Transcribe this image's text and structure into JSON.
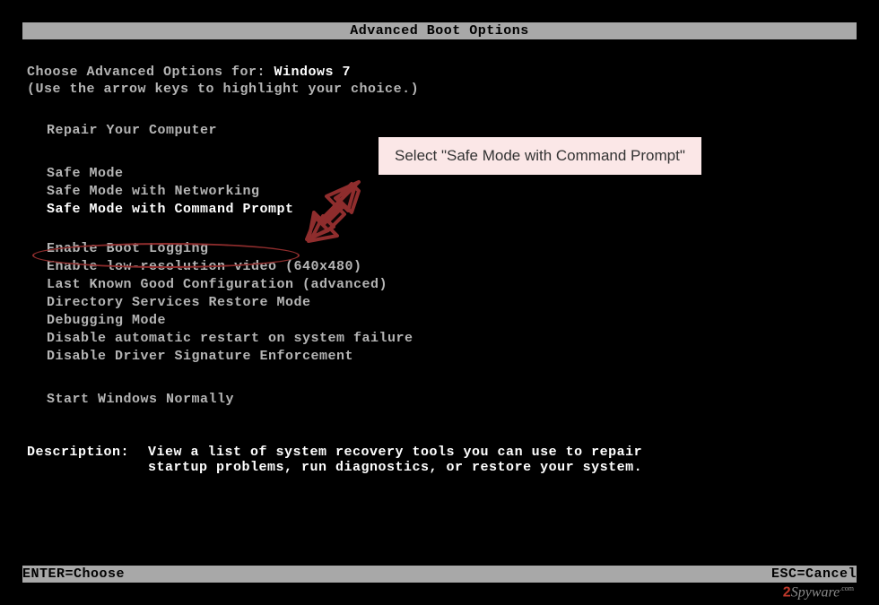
{
  "title": "Advanced Boot Options",
  "prompt_prefix": "Choose Advanced Options for: ",
  "os_name": "Windows 7",
  "hint": "(Use the arrow keys to highlight your choice.)",
  "repair_option": "Repair Your Computer",
  "safe_modes": {
    "basic": "Safe Mode",
    "networking": "Safe Mode with Networking",
    "cmd": "Safe Mode with Command Prompt"
  },
  "other_options": [
    "Enable Boot Logging",
    "Enable low-resolution video (640x480)",
    "Last Known Good Configuration (advanced)",
    "Directory Services Restore Mode",
    "Debugging Mode",
    "Disable automatic restart on system failure",
    "Disable Driver Signature Enforcement"
  ],
  "start_normally": "Start Windows Normally",
  "description": {
    "label": "Description:",
    "text_line1": "View a list of system recovery tools you can use to repair",
    "text_line2": "startup problems, run diagnostics, or restore your system."
  },
  "footer": {
    "enter": "ENTER=Choose",
    "esc": "ESC=Cancel"
  },
  "callout_text": "Select \"Safe Mode with Command Prompt\"",
  "watermark": {
    "two": "2",
    "name": "Spyware",
    "suffix": ".com"
  }
}
